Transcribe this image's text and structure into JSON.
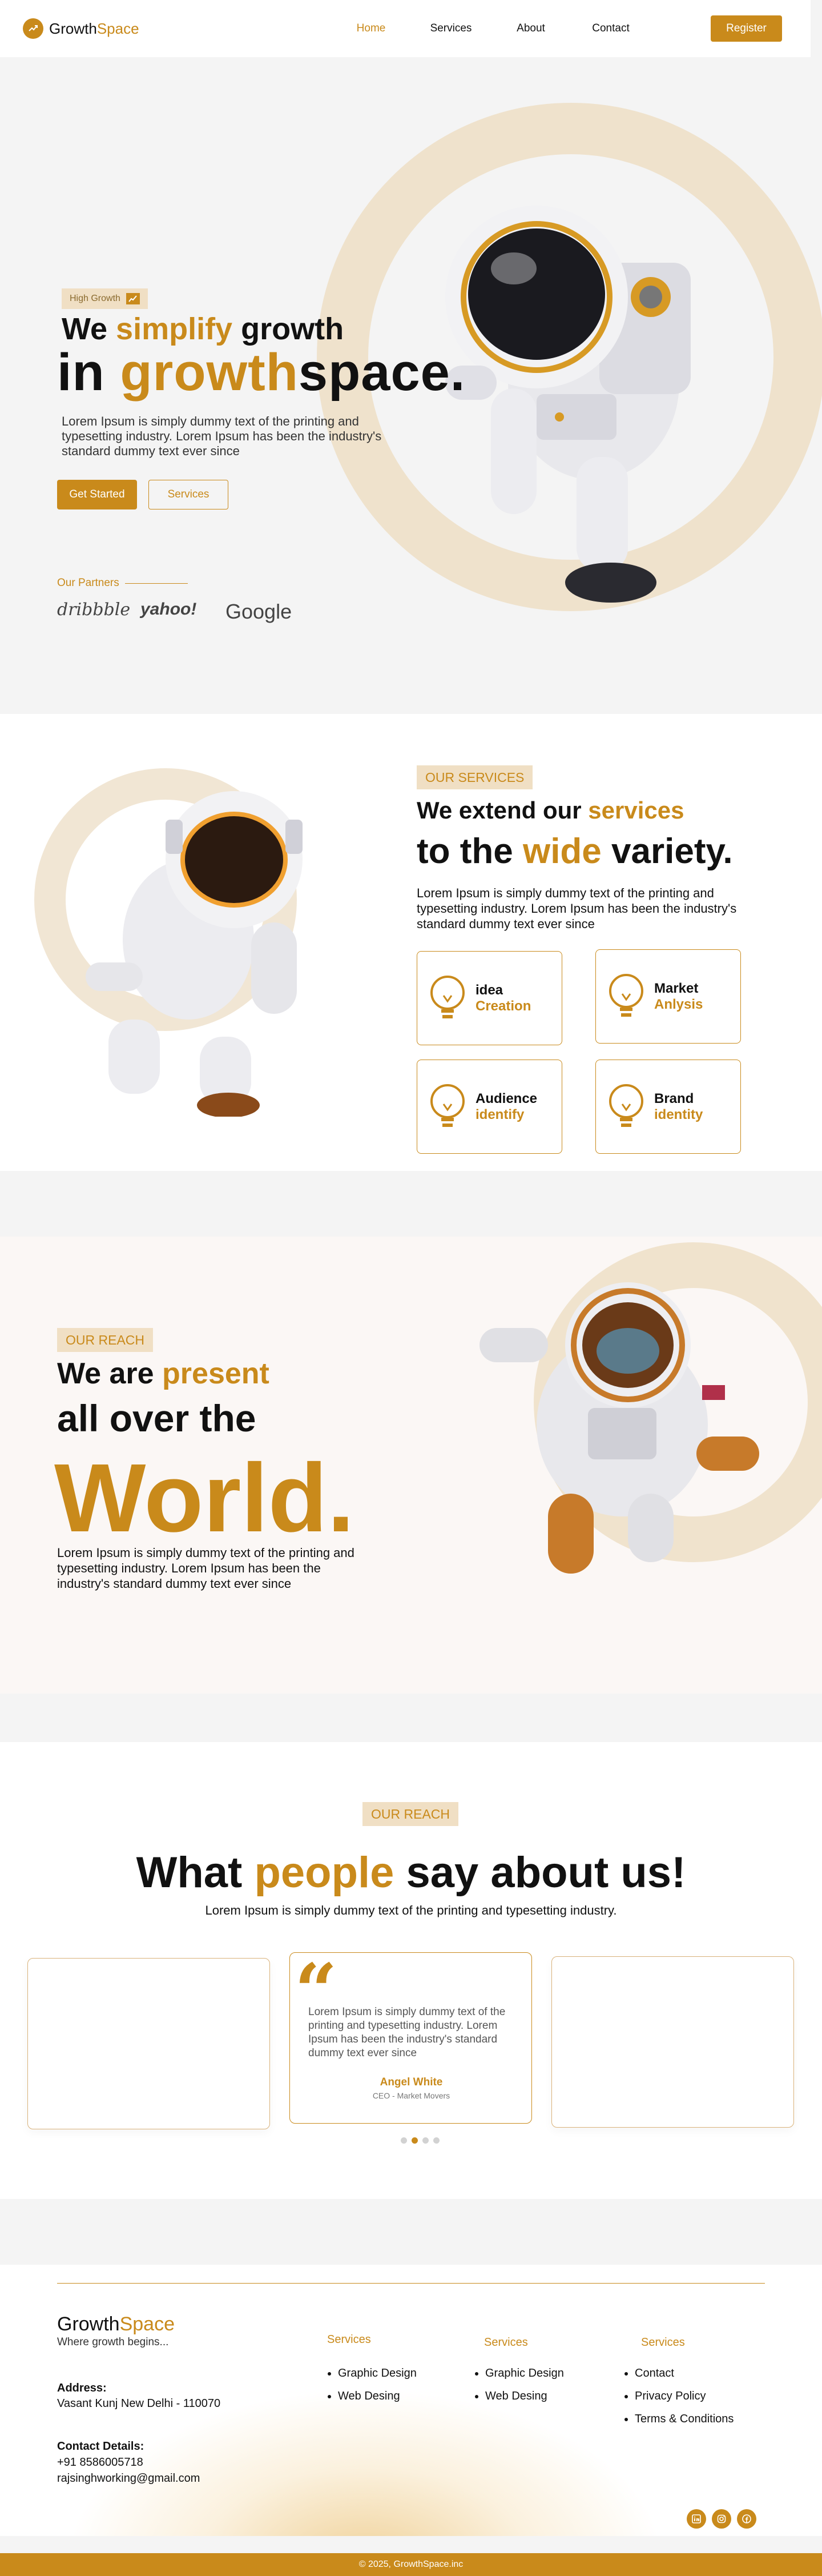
{
  "brand": {
    "name_part1": "Growth",
    "name_part2": "Space",
    "accent": "#c98a1b",
    "accent_light": "#f0dfc4"
  },
  "nav": {
    "links": [
      "Home",
      "Services",
      "About",
      "Contact"
    ],
    "active": "Home",
    "register_label": "Register"
  },
  "hero": {
    "badge": "High Growth",
    "line1_a": "We ",
    "line1_b": "simplify",
    "line1_c": " growth",
    "line2_a": "in ",
    "line2_b": "growth",
    "line2_c": "space.",
    "paragraph": "Lorem Ipsum is simply dummy text of the printing and typesetting industry. Lorem Ipsum has been the industry's standard dummy text ever since",
    "cta_primary": "Get Started",
    "cta_secondary": "Services",
    "partners_title": "Our Partners",
    "partners": [
      "dribbble",
      "yahoo!",
      "Google"
    ]
  },
  "services": {
    "badge": "OUR SERVICES",
    "h1_a": "We extend our ",
    "h1_b": "services",
    "h2_a": "to the ",
    "h2_b": "wide",
    "h2_c": " variety.",
    "paragraph": "Lorem Ipsum is simply dummy text of the printing and typesetting industry. Lorem Ipsum has been the industry's standard dummy text ever since",
    "cards": [
      {
        "t1": "idea",
        "t2": "Creation"
      },
      {
        "t1": "Market",
        "t2": "Anlysis"
      },
      {
        "t1": "Audience",
        "t2": "identify"
      },
      {
        "t1": "Brand",
        "t2": "identity"
      }
    ]
  },
  "reach": {
    "badge": "OUR REACH",
    "h1_a": "We are ",
    "h1_b": "present",
    "h2": "all over the",
    "h3": "World.",
    "paragraph": "Lorem Ipsum is simply dummy text of the printing and typesetting industry. Lorem Ipsum has been the industry's standard dummy text ever since"
  },
  "testimonials": {
    "badge": "OUR REACH",
    "heading_a": "What ",
    "heading_b": "people",
    "heading_c": " say about us!",
    "subheading": "Lorem Ipsum is simply dummy text of the printing and typesetting industry.",
    "quote_text": "Lorem Ipsum is simply dummy text of the printing and typesetting industry. Lorem Ipsum has been the industry's standard dummy text ever since",
    "author": "Angel White",
    "role": "CEO - Market Movers",
    "active_dot": 1,
    "dot_count": 4
  },
  "footer": {
    "tagline": "Where growth begins...",
    "address_label": "Address:",
    "address": "Vasant Kunj New Delhi - 110070",
    "contact_label": "Contact Details:",
    "phone": "+91 8586005718",
    "email": "rajsinghworking@gmail.com",
    "col1": {
      "title": "Services",
      "items": [
        "Graphic Design",
        "Web Desing"
      ]
    },
    "col2": {
      "title": "Services",
      "items": [
        "Graphic Design",
        "Web Desing"
      ]
    },
    "col3": {
      "title": "Services",
      "items": [
        "Contact",
        "Privacy Policy",
        "Terms & Conditions"
      ]
    },
    "socials": [
      "linkedin-icon",
      "instagram-icon",
      "facebook-icon"
    ],
    "copyright": "© 2025, GrowthSpace.inc"
  }
}
